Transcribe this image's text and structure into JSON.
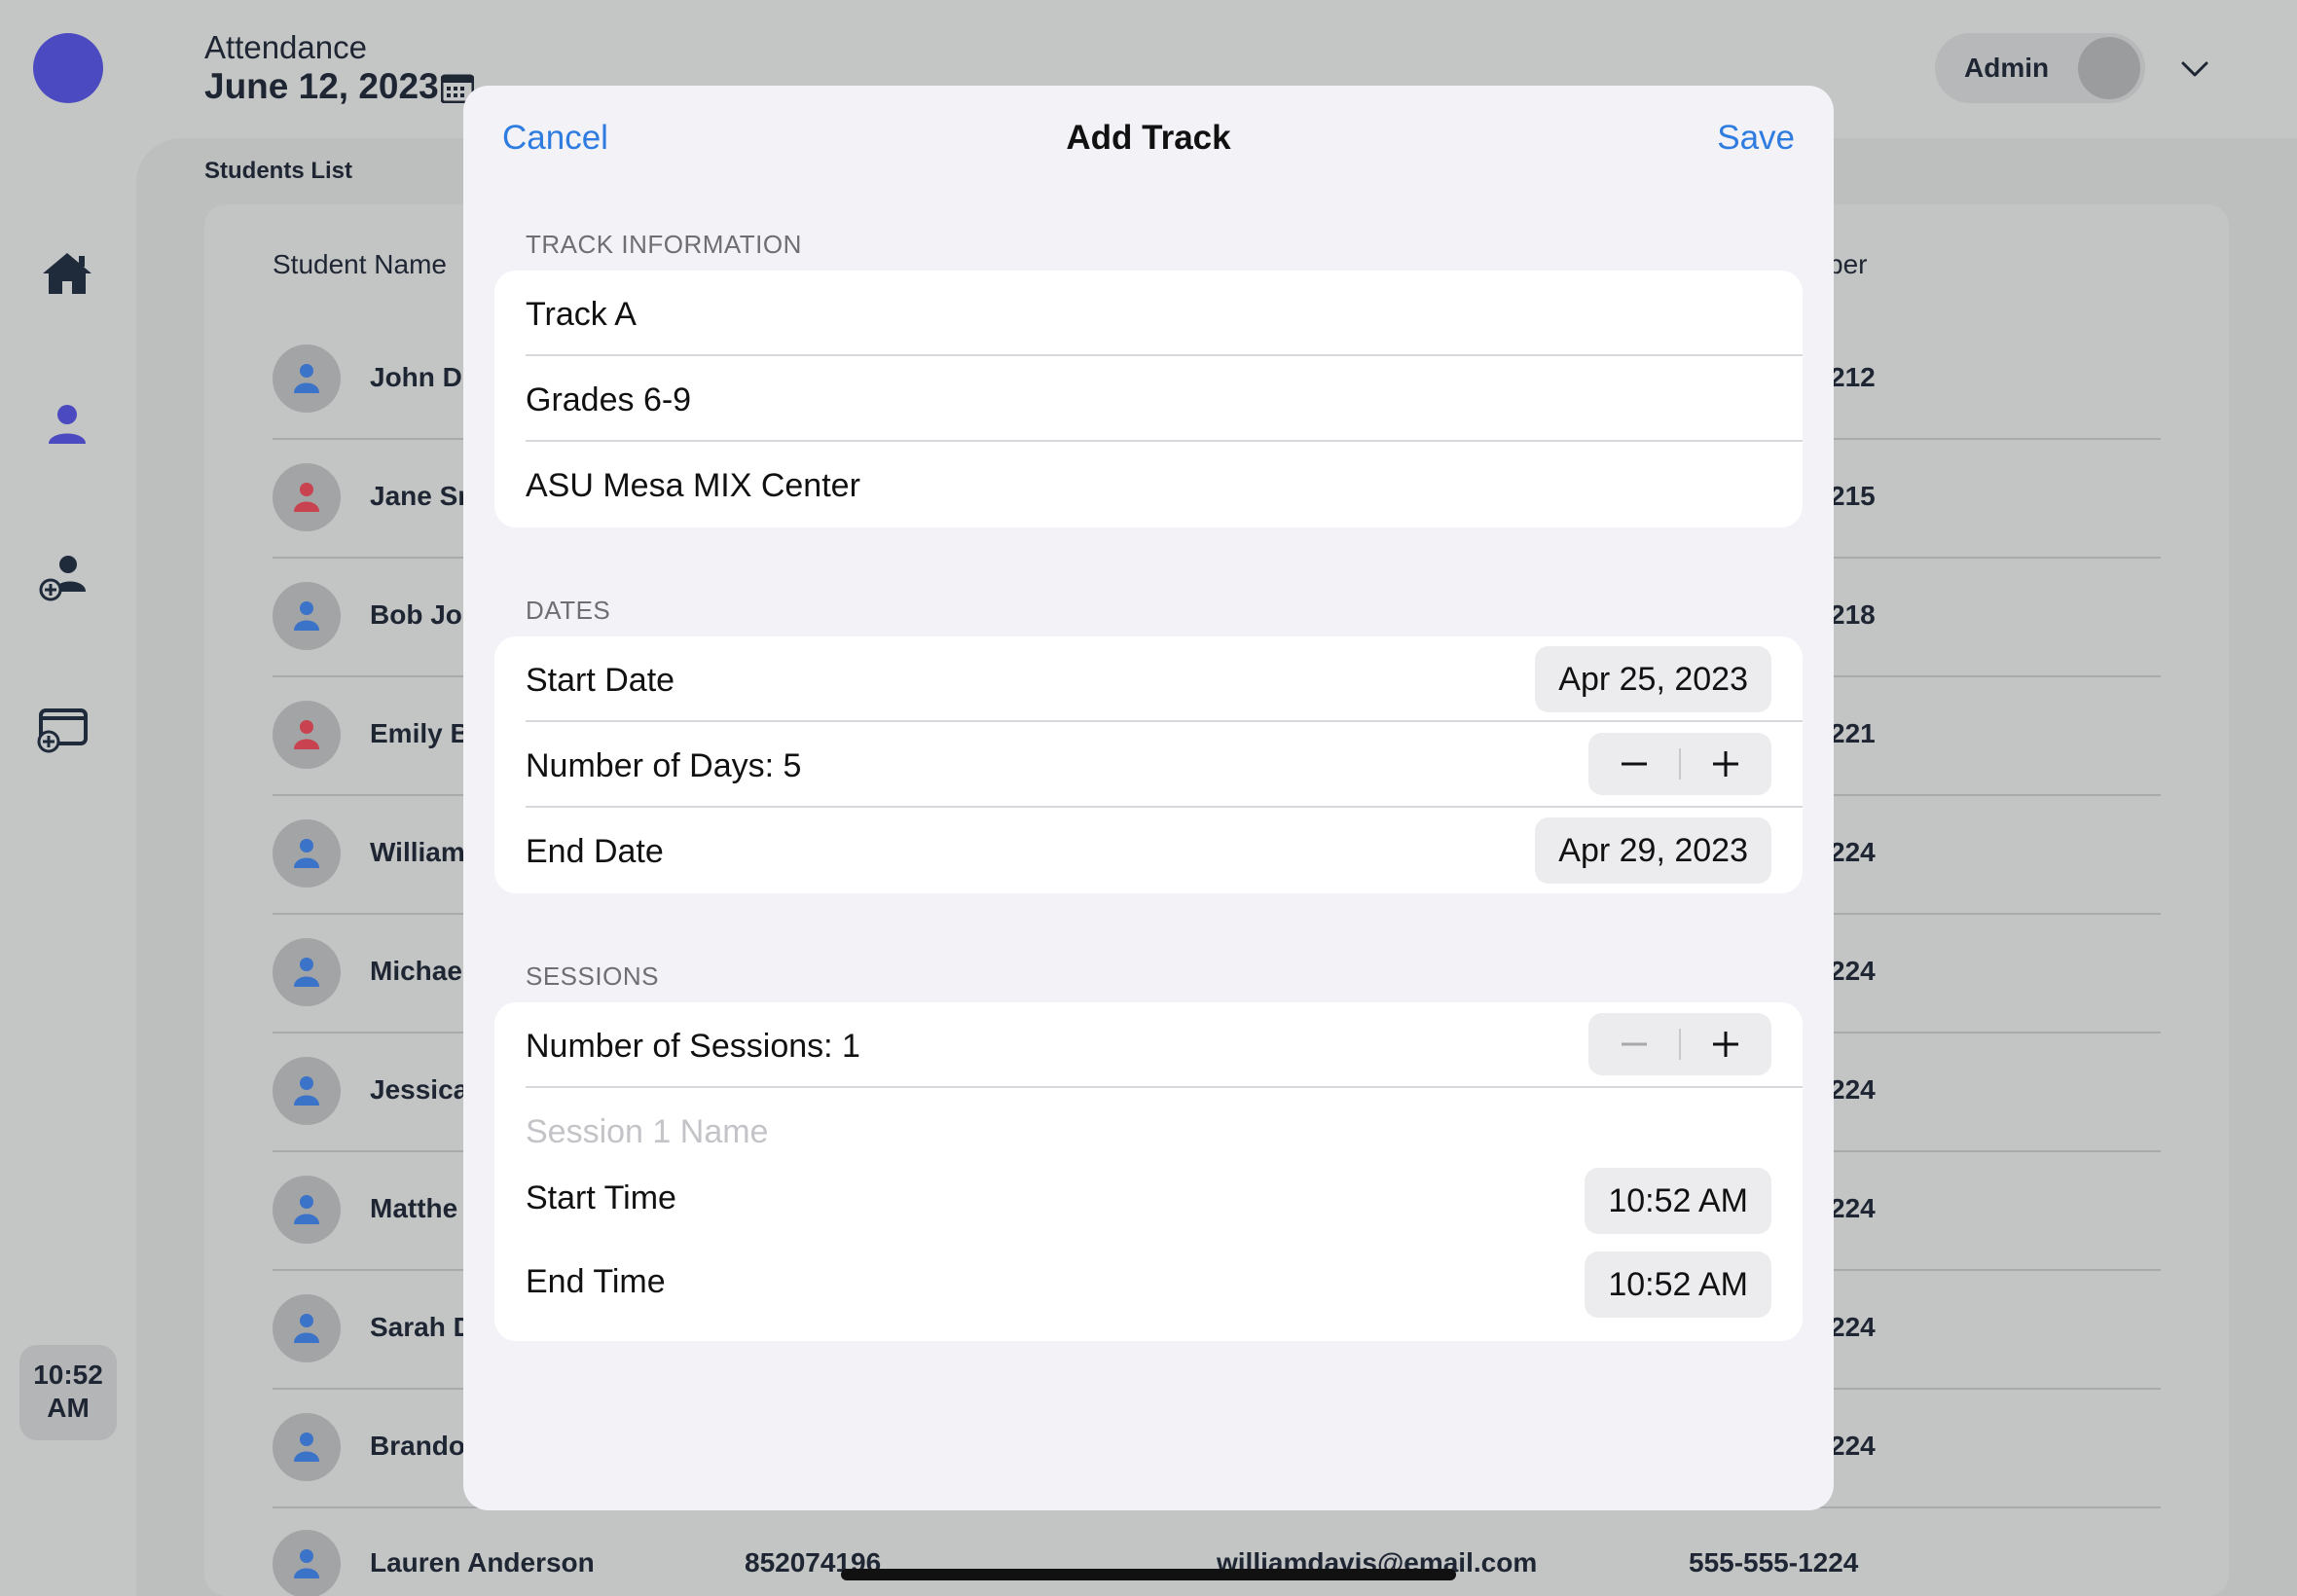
{
  "header": {
    "title": "Attendance",
    "date": "June 12, 2023",
    "user_label": "Admin"
  },
  "sidebar": {
    "items": [
      {
        "icon": "home-icon"
      },
      {
        "icon": "person-icon"
      },
      {
        "icon": "add-person-icon"
      },
      {
        "icon": "add-window-icon"
      }
    ],
    "time_line1": "10:52",
    "time_line2": "AM"
  },
  "students": {
    "heading": "Students List",
    "column_name": "Student Name",
    "column_partial": "ber",
    "rows": [
      {
        "name": "John D",
        "ext": "212",
        "gender": "m"
      },
      {
        "name": "Jane Sr",
        "ext": "215",
        "gender": "f"
      },
      {
        "name": "Bob Jol",
        "ext": "218",
        "gender": "m"
      },
      {
        "name": "Emily B",
        "ext": "221",
        "gender": "f"
      },
      {
        "name": "William",
        "ext": "224",
        "gender": "m"
      },
      {
        "name": "Michae",
        "ext": "224",
        "gender": "m"
      },
      {
        "name": "Jessica",
        "ext": "224",
        "gender": "m"
      },
      {
        "name": "Matthe",
        "ext": "224",
        "gender": "m"
      },
      {
        "name": "Sarah D",
        "ext": "224",
        "gender": "m"
      },
      {
        "name": "Brando",
        "ext": "224",
        "gender": "m"
      }
    ],
    "last_row": {
      "name": "Lauren Anderson",
      "id": "852074196",
      "email": "williamdavis@email.com",
      "phone": "555-555-1224"
    }
  },
  "modal": {
    "cancel_label": "Cancel",
    "title": "Add Track",
    "save_label": "Save",
    "track_info": {
      "label": "TRACK INFORMATION",
      "track_name": "Track A",
      "grades": "Grades 6-9",
      "location": "ASU Mesa MIX Center"
    },
    "dates": {
      "label": "DATES",
      "start_date_label": "Start Date",
      "start_date_value": "Apr 25, 2023",
      "num_days_label": "Number of Days: 5",
      "end_date_label": "End Date",
      "end_date_value": "Apr 29, 2023"
    },
    "sessions": {
      "label": "SESSIONS",
      "num_sessions_label": "Number of Sessions: 1",
      "session_name_placeholder": "Session 1 Name",
      "start_time_label": "Start Time",
      "start_time_value": "10:52 AM",
      "end_time_label": "End Time",
      "end_time_value": "10:52 AM"
    }
  },
  "colors": {
    "accent": "#2f7ce0",
    "brand": "#4b4ac0",
    "male_icon": "#3a73c8",
    "female_icon": "#c8434f"
  }
}
